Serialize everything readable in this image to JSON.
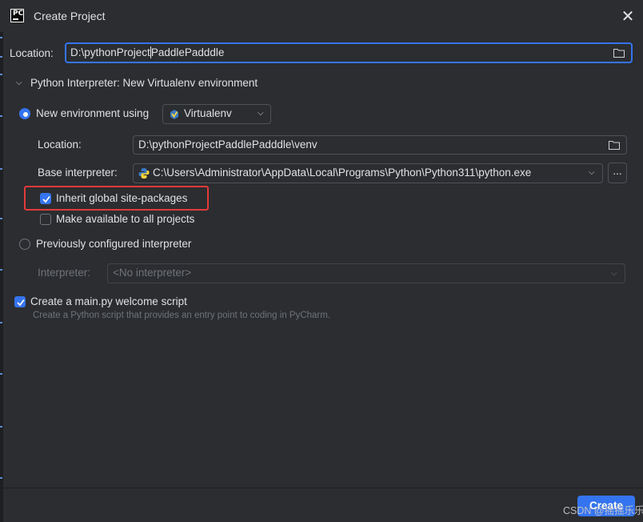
{
  "window": {
    "logo_text": "PC",
    "title": "Create Project",
    "close_icon": "close-icon"
  },
  "location": {
    "label": "Location:",
    "value_before_caret": "D:\\pythonProject",
    "value_after_caret": "PaddlePadddle",
    "browse_icon": "folder-icon"
  },
  "interpreter_section": {
    "title": "Python Interpreter: New Virtualenv environment",
    "new_env": {
      "label": "New environment using",
      "selected": true,
      "tool_select": "Virtualenv",
      "location_label": "Location:",
      "location_value": "D:\\pythonProjectPaddlePadddle\\venv",
      "base_label": "Base interpreter:",
      "base_value": "C:\\Users\\Administrator\\AppData\\Local\\Programs\\Python\\Python311\\python.exe",
      "more_button": "...",
      "inherit_label": "Inherit global site-packages",
      "inherit_checked": true,
      "available_label": "Make available to all projects",
      "available_checked": false
    },
    "previous": {
      "label": "Previously configured interpreter",
      "selected": false,
      "interpreter_label": "Interpreter:",
      "interpreter_value": "<No interpreter>"
    }
  },
  "welcome": {
    "label": "Create a main.py welcome script",
    "checked": true,
    "hint": "Create a Python script that provides an entry point to coding in PyCharm."
  },
  "footer": {
    "create_label": "Create",
    "watermark": "CSDN @摇摇乐乐乐"
  },
  "colors": {
    "background": "#2b2d30",
    "accent": "#3574f0",
    "highlight_box": "#e23a3a"
  }
}
